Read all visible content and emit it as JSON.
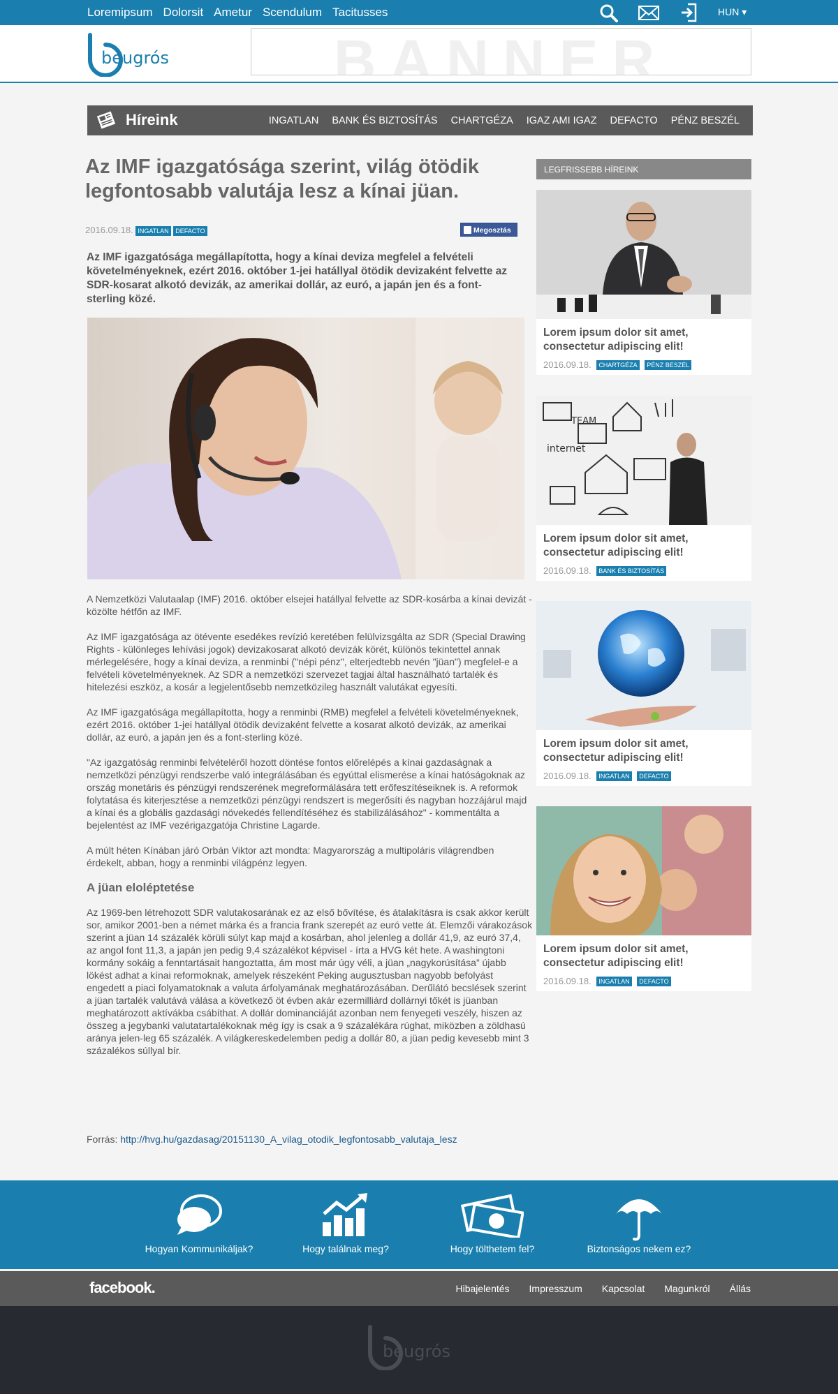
{
  "topnav": {
    "items": [
      "Loremipsum",
      "Dolorsit",
      "Ametur",
      "Scendulum",
      "Tacitusses"
    ],
    "icons": [
      "search-icon",
      "mail-icon",
      "login-icon"
    ],
    "lang": "HUN ▾"
  },
  "header": {
    "logo_text": "beugrós",
    "banner_text": "BANNER"
  },
  "category_bar": {
    "title": "Híreink",
    "items": [
      "INGATLAN",
      "BANK ÉS BIZTOSÍTÁS",
      "CHARTGÉZA",
      "IGAZ AMI IGAZ",
      "DEFACTO",
      "PÉNZ BESZÉL"
    ]
  },
  "article": {
    "title": "Az IMF igazgatósága szerint, világ ötödik legfontosabb valutája lesz a kínai jüan.",
    "date": "2016.09.18.",
    "tags": [
      "INGATLAN",
      "DEFACTO"
    ],
    "share_label": "Megosztás",
    "lead": "Az IMF igazgatósága megállapította, hogy a kínai deviza megfelel a felvételi követelményeknek, ezért 2016. október 1-jei hatállyal ötödik devizaként felvette az SDR-kosarat alkotó devizák, az amerikai dollár, az euró, a japán jen és a font-sterling közé.",
    "paragraphs": [
      "A Nemzetközi Valutaalap (IMF) 2016. október elsejei hatállyal felvette az SDR-kosárba a kínai devizát - közölte hétfőn az IMF.",
      "Az IMF igazgatósága az ötévente esedékes revízió keretében felülvizsgálta az SDR (Special Drawing Rights - különleges lehívási jogok) devizakosarat alkotó devizák körét, különös tekintettel annak mérlegelésére, hogy a kínai deviza, a renminbi (\"népi pénz\", elterjedtebb nevén \"jüan\") megfelel-e a felvételi követelményeknek. Az SDR a nemzetközi szervezet tagjai által használható tartalék és hitelezési eszköz, a kosár a legjelentősebb nemzetközileg használt valutákat egyesíti.",
      "Az IMF igazgatósága megállapította, hogy a renminbi (RMB) megfelel a felvételi követelményeknek, ezért 2016. október 1-jei hatállyal ötödik devizaként felvette a kosarat alkotó devizák, az amerikai dollár, az euró, a japán jen és a font-sterling közé.",
      "\"Az igazgatóság renminbi felvételéről hozott döntése fontos előrelépés a kínai gazdaságnak a nemzetközi pénzügyi rendszerbe való integrálásában és egyúttal elismerése a kínai hatóságoknak az ország monetáris és pénzügyi rendszerének megreformálására tett erőfeszítéseiknek is. A reformok folytatása és kiterjesztése a nemzetközi pénzügyi rendszert is megerősíti és nagyban hozzájárul majd a kínai és a globális gazdasági növekedés fellendítéséhez és stabilizálásához\" - kommentálta a bejelentést az IMF vezérigazgatója Christine Lagarde.",
      "A múlt héten Kínában járó Orbán Viktor azt mondta: Magyarország a multipoláris világrendben érdekelt, abban, hogy a renminbi világpénz legyen."
    ],
    "subheading": "A jüan eloléptetése",
    "paragraph_after": "Az 1969-ben létrehozott SDR valutakosarának ez az első bővítése, és átalakításra is csak akkor került sor, amikor 2001-ben a német márka és a francia frank szerepét az euró vette át. Elemzői várakozások szerint a jüan 14 százalék körüli súlyt kap majd a kosárban, ahol jelenleg a dollár 41,9, az euró 37,4, az angol font 11,3, a japán jen pedig 9,4 százalékot képvisel - írta a HVG két hete. A washingtoni kormány sokáig a fenntartásait hangoztatta, ám most már úgy véli, a jüan „nagykorúsítása” újabb lökést adhat a kínai reformoknak, amelyek részeként Peking augusztusban nagyobb befolyást engedett a piaci folyamatoknak a valuta árfolyamának meghatározásában. Derűlátó becslések szerint a jüan tartalék valutává válása a következő öt évben akár ezermilliárd dollárnyi tőkét is jüanban meghatározott aktívákba csábíthat. A dollár dominanciáját azonban nem fenyegeti veszély, hiszen az összeg a jegybanki valutatartalékoknak még így is csak a 9 százalékára rúghat, miközben a zöldhasú aránya jelen-leg 65 százalék. A világkereskedelemben pedig a dollár 80, a jüan pedig kevesebb mint 3 százalékos súllyal bír.",
    "source_label": "Forrás:",
    "source_link": "http://hvg.hu/gazdasag/20151130_A_vilag_otodik_legfontosabb_valutaja_lesz"
  },
  "sidebar": {
    "heading": "LEGFRISSEBB HÍREINK",
    "cards": [
      {
        "title": "Lorem ipsum dolor sit amet, consectetur adipiscing elit!",
        "date": "2016.09.18.",
        "tags": [
          "CHARTGÉZA",
          "PÉNZ BESZÉL"
        ]
      },
      {
        "title": "Lorem ipsum dolor sit amet, consectetur adipiscing elit!",
        "date": "2016.09.18.",
        "tags": [
          "BANK ÉS BIZTOSÍTÁS"
        ]
      },
      {
        "title": "Lorem ipsum dolor sit amet, consectetur adipiscing elit!",
        "date": "2016.09.18.",
        "tags": [
          "INGATLAN",
          "DEFACTO"
        ]
      },
      {
        "title": "Lorem ipsum dolor sit amet, consectetur adipiscing elit!",
        "date": "2016.09.18.",
        "tags": [
          "INGATLAN",
          "DEFACTO"
        ]
      }
    ]
  },
  "band": {
    "items": [
      {
        "label": "Hogyan Kommunikáljak?",
        "icon": "chat-bubbles-icon"
      },
      {
        "label": "Hogy találnak meg?",
        "icon": "growth-chart-icon"
      },
      {
        "label": "Hogy tölthetem fel?",
        "icon": "money-icon"
      },
      {
        "label": "Biztonságos nekem ez?",
        "icon": "umbrella-icon"
      }
    ]
  },
  "footer": {
    "facebook": "facebook.",
    "links": [
      "Hibajelentés",
      "Impresszum",
      "Kapcsolat",
      "Magunkról",
      "Állás"
    ],
    "logo_text": "beugrós"
  },
  "colors": {
    "brand_blue": "#1a7fae",
    "dark_gray": "#5a5a5a",
    "footer_dark": "#272a31"
  }
}
